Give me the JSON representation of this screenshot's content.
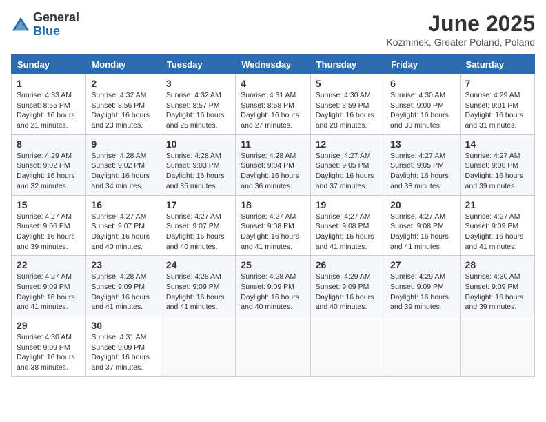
{
  "header": {
    "logo_general": "General",
    "logo_blue": "Blue",
    "month_title": "June 2025",
    "location": "Kozminek, Greater Poland, Poland"
  },
  "days_of_week": [
    "Sunday",
    "Monday",
    "Tuesday",
    "Wednesday",
    "Thursday",
    "Friday",
    "Saturday"
  ],
  "weeks": [
    [
      {
        "day": 1,
        "sunrise": "4:33 AM",
        "sunset": "8:55 PM",
        "daylight": "16 hours and 21 minutes."
      },
      {
        "day": 2,
        "sunrise": "4:32 AM",
        "sunset": "8:56 PM",
        "daylight": "16 hours and 23 minutes."
      },
      {
        "day": 3,
        "sunrise": "4:32 AM",
        "sunset": "8:57 PM",
        "daylight": "16 hours and 25 minutes."
      },
      {
        "day": 4,
        "sunrise": "4:31 AM",
        "sunset": "8:58 PM",
        "daylight": "16 hours and 27 minutes."
      },
      {
        "day": 5,
        "sunrise": "4:30 AM",
        "sunset": "8:59 PM",
        "daylight": "16 hours and 28 minutes."
      },
      {
        "day": 6,
        "sunrise": "4:30 AM",
        "sunset": "9:00 PM",
        "daylight": "16 hours and 30 minutes."
      },
      {
        "day": 7,
        "sunrise": "4:29 AM",
        "sunset": "9:01 PM",
        "daylight": "16 hours and 31 minutes."
      }
    ],
    [
      {
        "day": 8,
        "sunrise": "4:29 AM",
        "sunset": "9:02 PM",
        "daylight": "16 hours and 32 minutes."
      },
      {
        "day": 9,
        "sunrise": "4:28 AM",
        "sunset": "9:02 PM",
        "daylight": "16 hours and 34 minutes."
      },
      {
        "day": 10,
        "sunrise": "4:28 AM",
        "sunset": "9:03 PM",
        "daylight": "16 hours and 35 minutes."
      },
      {
        "day": 11,
        "sunrise": "4:28 AM",
        "sunset": "9:04 PM",
        "daylight": "16 hours and 36 minutes."
      },
      {
        "day": 12,
        "sunrise": "4:27 AM",
        "sunset": "9:05 PM",
        "daylight": "16 hours and 37 minutes."
      },
      {
        "day": 13,
        "sunrise": "4:27 AM",
        "sunset": "9:05 PM",
        "daylight": "16 hours and 38 minutes."
      },
      {
        "day": 14,
        "sunrise": "4:27 AM",
        "sunset": "9:06 PM",
        "daylight": "16 hours and 39 minutes."
      }
    ],
    [
      {
        "day": 15,
        "sunrise": "4:27 AM",
        "sunset": "9:06 PM",
        "daylight": "16 hours and 39 minutes."
      },
      {
        "day": 16,
        "sunrise": "4:27 AM",
        "sunset": "9:07 PM",
        "daylight": "16 hours and 40 minutes."
      },
      {
        "day": 17,
        "sunrise": "4:27 AM",
        "sunset": "9:07 PM",
        "daylight": "16 hours and 40 minutes."
      },
      {
        "day": 18,
        "sunrise": "4:27 AM",
        "sunset": "9:08 PM",
        "daylight": "16 hours and 41 minutes."
      },
      {
        "day": 19,
        "sunrise": "4:27 AM",
        "sunset": "9:08 PM",
        "daylight": "16 hours and 41 minutes."
      },
      {
        "day": 20,
        "sunrise": "4:27 AM",
        "sunset": "9:08 PM",
        "daylight": "16 hours and 41 minutes."
      },
      {
        "day": 21,
        "sunrise": "4:27 AM",
        "sunset": "9:09 PM",
        "daylight": "16 hours and 41 minutes."
      }
    ],
    [
      {
        "day": 22,
        "sunrise": "4:27 AM",
        "sunset": "9:09 PM",
        "daylight": "16 hours and 41 minutes."
      },
      {
        "day": 23,
        "sunrise": "4:28 AM",
        "sunset": "9:09 PM",
        "daylight": "16 hours and 41 minutes."
      },
      {
        "day": 24,
        "sunrise": "4:28 AM",
        "sunset": "9:09 PM",
        "daylight": "16 hours and 41 minutes."
      },
      {
        "day": 25,
        "sunrise": "4:28 AM",
        "sunset": "9:09 PM",
        "daylight": "16 hours and 40 minutes."
      },
      {
        "day": 26,
        "sunrise": "4:29 AM",
        "sunset": "9:09 PM",
        "daylight": "16 hours and 40 minutes."
      },
      {
        "day": 27,
        "sunrise": "4:29 AM",
        "sunset": "9:09 PM",
        "daylight": "16 hours and 39 minutes."
      },
      {
        "day": 28,
        "sunrise": "4:30 AM",
        "sunset": "9:09 PM",
        "daylight": "16 hours and 39 minutes."
      }
    ],
    [
      {
        "day": 29,
        "sunrise": "4:30 AM",
        "sunset": "9:09 PM",
        "daylight": "16 hours and 38 minutes."
      },
      {
        "day": 30,
        "sunrise": "4:31 AM",
        "sunset": "9:09 PM",
        "daylight": "16 hours and 37 minutes."
      },
      null,
      null,
      null,
      null,
      null
    ]
  ]
}
